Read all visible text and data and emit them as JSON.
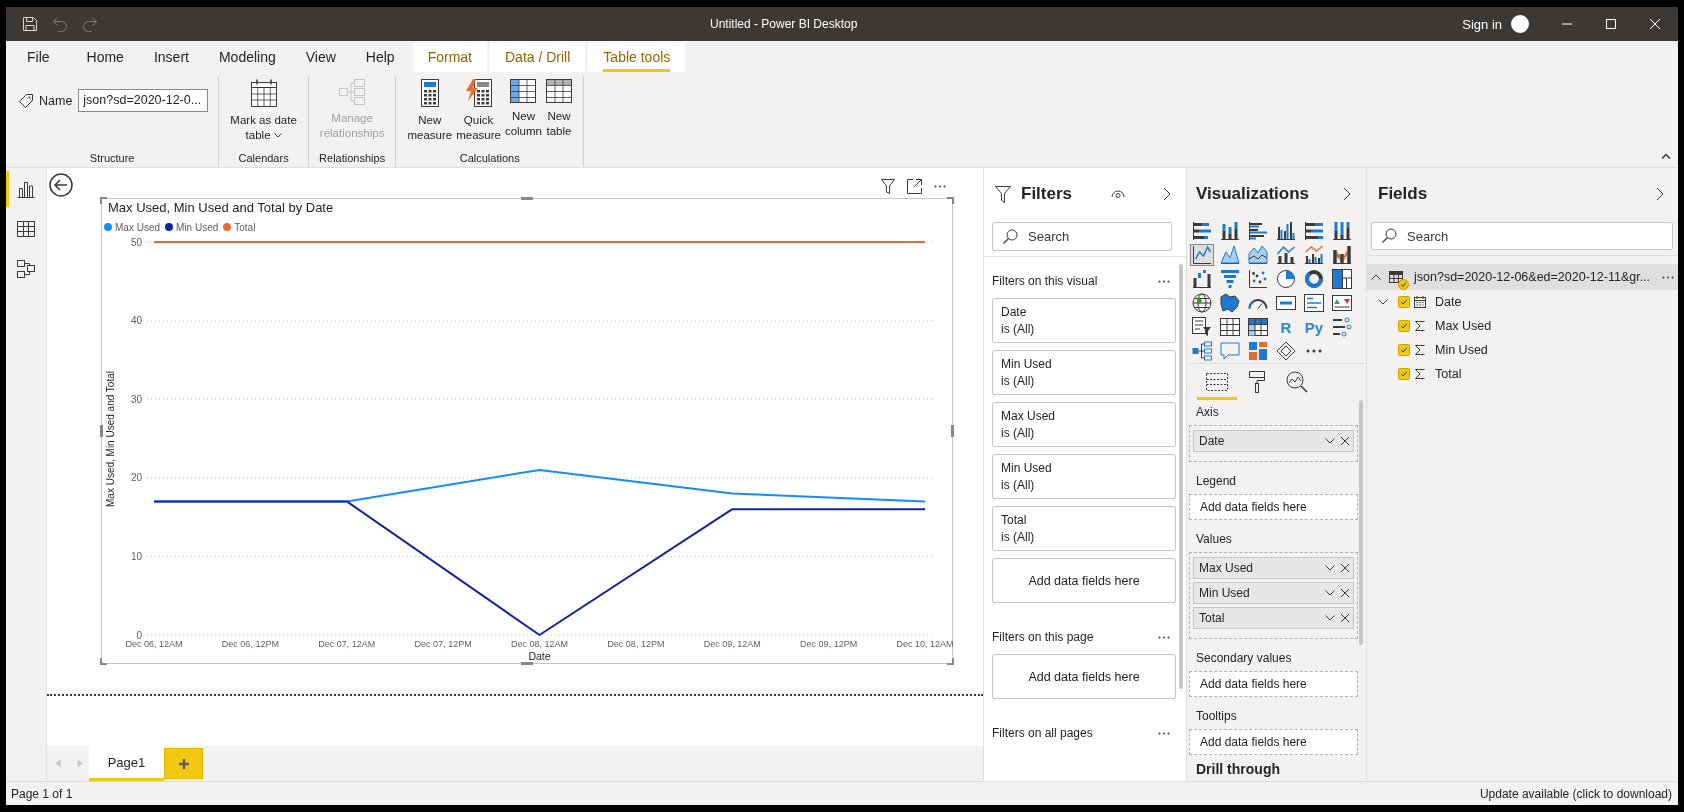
{
  "title_bar": {
    "quick_access": [
      {
        "kind": "save",
        "disabled": false
      },
      {
        "kind": "undo",
        "disabled": true
      },
      {
        "kind": "redo",
        "disabled": true
      }
    ],
    "title": "Untitled - Power BI Desktop",
    "sign_in": "Sign in"
  },
  "ribbon_tabs": [
    {
      "label": "File",
      "kind": "file",
      "selected": false
    },
    {
      "label": "Home",
      "kind": "standard",
      "selected": false
    },
    {
      "label": "Insert",
      "kind": "standard",
      "selected": false
    },
    {
      "label": "Modeling",
      "kind": "standard",
      "selected": false
    },
    {
      "label": "View",
      "kind": "standard",
      "selected": false
    },
    {
      "label": "Help",
      "kind": "standard",
      "selected": false
    },
    {
      "label": "Format",
      "kind": "contextual",
      "selected": false
    },
    {
      "label": "Data / Drill",
      "kind": "contextual",
      "selected": false
    },
    {
      "label": "Table tools",
      "kind": "contextual",
      "selected": true
    }
  ],
  "ribbon_groups": [
    {
      "label": "Structure",
      "name_field": {
        "label": "Name",
        "value": "json?sd=2020-12-0..."
      }
    },
    {
      "label": "Calendars",
      "buttons": [
        {
          "kind": "date-table",
          "label": "Mark as date\ntable",
          "dropdown": true,
          "disabled": false
        }
      ]
    },
    {
      "label": "Relationships",
      "buttons": [
        {
          "kind": "relationships",
          "label": "Manage\nrelationships",
          "dropdown": false,
          "disabled": true
        }
      ]
    },
    {
      "label": "Calculations",
      "buttons": [
        {
          "kind": "measure",
          "label": "New\nmeasure",
          "dropdown": false,
          "disabled": false
        },
        {
          "kind": "quick-measure",
          "label": "Quick\nmeasure",
          "dropdown": false,
          "disabled": false
        },
        {
          "kind": "column",
          "label": "New\ncolumn",
          "dropdown": false,
          "disabled": false
        },
        {
          "kind": "table",
          "label": "New\ntable",
          "dropdown": false,
          "disabled": false
        }
      ]
    }
  ],
  "views": [
    {
      "kind": "report",
      "selected": true
    },
    {
      "kind": "data",
      "selected": false
    },
    {
      "kind": "model",
      "selected": false
    }
  ],
  "report_visual": {
    "chart_data": {
      "type": "line",
      "title": "Max Used, Min Used and Total by Date",
      "xlabel": "Date",
      "ylabel": "Max Used, Min Used and Total",
      "legend": "top-left",
      "grid": true,
      "categories": [
        "Dec 06, 12AM",
        "Dec 06, 12PM",
        "Dec 07, 12AM",
        "Dec 07, 12PM",
        "Dec 08, 12AM",
        "Dec 08, 12PM",
        "Dec 09, 12AM",
        "Dec 09, 12PM",
        "Dec 10, 12AM"
      ],
      "ylim": [
        0,
        50
      ],
      "yticks": [
        0,
        10,
        20,
        30,
        40,
        50
      ],
      "series": [
        {
          "name": "Max Used",
          "color": "#118dff",
          "values": [
            17,
            null,
            17,
            null,
            21,
            null,
            18,
            null,
            17
          ]
        },
        {
          "name": "Min Used",
          "color": "#12239e",
          "values": [
            17,
            null,
            17,
            null,
            0,
            null,
            16,
            null,
            16
          ]
        },
        {
          "name": "Total",
          "color": "#e66c37",
          "values": [
            50,
            null,
            50,
            null,
            50,
            null,
            50,
            null,
            50
          ]
        }
      ]
    }
  },
  "page_tabs": [
    {
      "label": "Page1",
      "selected": true
    }
  ],
  "filters_pane": {
    "title": "Filters",
    "search": {
      "placeholder": "Search"
    },
    "sections": [
      {
        "title": "Filters on this visual",
        "cards": [
          {
            "field": "Date",
            "condition": "is (All)"
          },
          {
            "field": "Min Used",
            "condition": "is (All)"
          },
          {
            "field": "Max Used",
            "condition": "is (All)"
          },
          {
            "field": "Min Used",
            "condition": "is (All)"
          },
          {
            "field": "Total",
            "condition": "is (All)"
          }
        ],
        "drop_hint": "Add data fields here"
      },
      {
        "title": "Filters on this page",
        "drop_hint": "Add data fields here"
      },
      {
        "title": "Filters on all pages"
      }
    ]
  },
  "visualizations_pane": {
    "title": "Visualizations",
    "gallery": [
      {
        "kind": "stacked-bar",
        "selected": false
      },
      {
        "kind": "stacked-column",
        "selected": false
      },
      {
        "kind": "clustered-bar",
        "selected": false
      },
      {
        "kind": "clustered-column",
        "selected": false
      },
      {
        "kind": "percent-bar",
        "selected": false
      },
      {
        "kind": "percent-column",
        "selected": false
      },
      {
        "kind": "line",
        "selected": true
      },
      {
        "kind": "area",
        "selected": false
      },
      {
        "kind": "stacked-area",
        "selected": false
      },
      {
        "kind": "line-column",
        "selected": false
      },
      {
        "kind": "line-clustered-column",
        "selected": false
      },
      {
        "kind": "ribbon",
        "selected": false
      },
      {
        "kind": "waterfall",
        "selected": false
      },
      {
        "kind": "funnel",
        "selected": false
      },
      {
        "kind": "scatter",
        "selected": false
      },
      {
        "kind": "pie",
        "selected": false
      },
      {
        "kind": "donut",
        "selected": false
      },
      {
        "kind": "treemap",
        "selected": false
      },
      {
        "kind": "map",
        "selected": false
      },
      {
        "kind": "filled-map",
        "selected": false
      },
      {
        "kind": "gauge",
        "selected": false
      },
      {
        "kind": "card",
        "selected": false
      },
      {
        "kind": "multi-row-card",
        "selected": false
      },
      {
        "kind": "kpi",
        "selected": false
      },
      {
        "kind": "slicer",
        "selected": false
      },
      {
        "kind": "table",
        "selected": false
      },
      {
        "kind": "matrix",
        "selected": false
      },
      {
        "kind": "r-script",
        "label": "R",
        "selected": false
      },
      {
        "kind": "python",
        "label": "Py",
        "selected": false
      },
      {
        "kind": "key-influencers",
        "selected": false
      },
      {
        "kind": "decomposition-tree",
        "selected": false
      },
      {
        "kind": "qna",
        "selected": false
      },
      {
        "kind": "shape-map",
        "selected": false
      },
      {
        "kind": "power-apps",
        "selected": false
      },
      {
        "kind": "more",
        "selected": false
      }
    ],
    "tabs": [
      {
        "kind": "fields",
        "selected": true
      },
      {
        "kind": "format",
        "selected": false
      },
      {
        "kind": "analytics",
        "selected": false
      }
    ],
    "wells": [
      {
        "title": "Axis",
        "fields": [
          "Date"
        ]
      },
      {
        "title": "Legend",
        "drop_hint": "Add data fields here"
      },
      {
        "title": "Values",
        "fields": [
          "Max Used",
          "Min Used",
          "Total"
        ]
      },
      {
        "title": "Secondary values",
        "drop_hint": "Add data fields here"
      },
      {
        "title": "Tooltips",
        "drop_hint": "Add data fields here"
      },
      {
        "title": "Drill through"
      }
    ]
  },
  "fields_pane": {
    "title": "Fields",
    "search": {
      "placeholder": "Search"
    },
    "tables": [
      {
        "name": "json?sd=2020-12-06&ed=2020-12-11&gr...",
        "expanded": true,
        "selected": true,
        "in_use": true,
        "children": [
          {
            "name": "Date",
            "kind": "date",
            "checked": true,
            "expanded": false
          },
          {
            "name": "Max Used",
            "kind": "numeric",
            "checked": true
          },
          {
            "name": "Min Used",
            "kind": "numeric",
            "checked": true
          },
          {
            "name": "Total",
            "kind": "numeric",
            "checked": true
          }
        ]
      }
    ]
  },
  "status_bar": {
    "page_info": "Page 1 of 1",
    "update_link": "Update available (click to download)"
  }
}
